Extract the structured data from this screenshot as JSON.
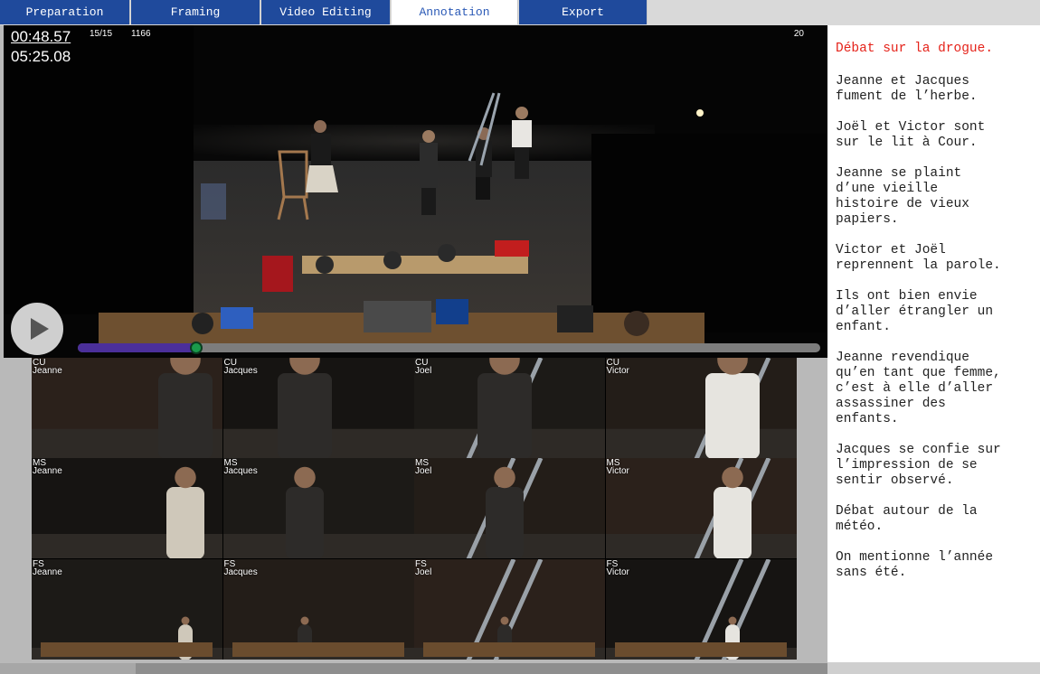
{
  "tabs": [
    {
      "label": "Preparation",
      "active": false
    },
    {
      "label": "Framing",
      "active": false
    },
    {
      "label": "Video Editing",
      "active": false
    },
    {
      "label": "Annotation",
      "active": true
    },
    {
      "label": "Export",
      "active": false
    }
  ],
  "player": {
    "current_time": "00:48.57",
    "total_time": "05:25.08",
    "shot_count": "15/15",
    "frame_number": "1166",
    "right_number": "20",
    "progress_fraction": 0.16
  },
  "cameras": [
    {
      "shot": "CU",
      "actor": "Jeanne"
    },
    {
      "shot": "CU",
      "actor": "Jacques"
    },
    {
      "shot": "CU",
      "actor": "Joel"
    },
    {
      "shot": "CU",
      "actor": "Victor"
    },
    {
      "shot": "MS",
      "actor": "Jeanne"
    },
    {
      "shot": "MS",
      "actor": "Jacques"
    },
    {
      "shot": "MS",
      "actor": "Joel"
    },
    {
      "shot": "MS",
      "actor": "Victor"
    },
    {
      "shot": "FS",
      "actor": "Jeanne"
    },
    {
      "shot": "FS",
      "actor": "Jacques"
    },
    {
      "shot": "FS",
      "actor": "Joel"
    },
    {
      "shot": "FS",
      "actor": "Victor"
    }
  ],
  "notes": [
    "Débat sur la drogue.",
    "Jeanne et Jacques\nfument de l’herbe.",
    "Joël et Victor sont\nsur le lit à Cour.",
    "Jeanne se plaint\nd’une vieille\nhistoire de vieux\npapiers.",
    "Victor et Joël\nreprennent la parole.",
    "Ils ont bien envie\nd’aller étrangler un\nenfant.",
    "Jeanne revendique\nqu’en tant que femme,\nc’est à elle d’aller\nassassiner des\nenfants.",
    "Jacques se confie sur\nl’impression de se\nsentir observé.",
    "Débat autour de la\nmétéo.",
    "On mentionne l’année\nsans été."
  ],
  "colors": {
    "tab_bg": "#1f4a9c",
    "tab_active_text": "#2a59b6",
    "note_highlight": "#e5231a",
    "seek_progress": "#4b2f9a",
    "seek_knob": "#1a9a4b"
  }
}
